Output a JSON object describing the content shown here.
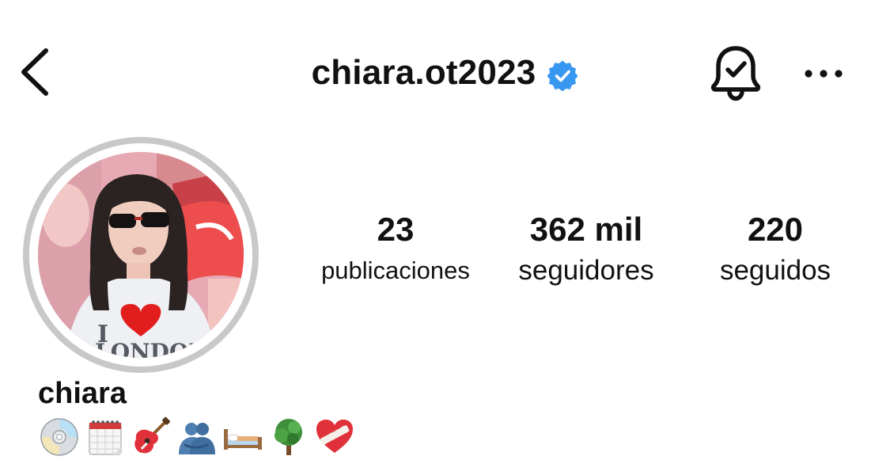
{
  "header": {
    "username": "chiara.ot2023",
    "verified": true,
    "badge_color": "#3897f0"
  },
  "actions": {
    "back_icon": "chevron-left-icon",
    "notification_icon": "bell-check-icon",
    "more_icon": "more-horizontal-icon"
  },
  "avatar": {
    "ring_color": "#c8c8c8",
    "shirt_text": "I ❤ LONDON"
  },
  "stats": {
    "posts": {
      "value": "23",
      "label": "publicaciones"
    },
    "followers": {
      "value": "362 mil",
      "label": "seguidores"
    },
    "following": {
      "value": "220",
      "label": "seguidos"
    }
  },
  "profile": {
    "name": "chiara",
    "bio_emojis": [
      "cd-icon",
      "calendar-icon",
      "guitar-icon",
      "people-hugging-icon",
      "bed-icon",
      "tree-icon",
      "mending-heart-icon"
    ]
  }
}
